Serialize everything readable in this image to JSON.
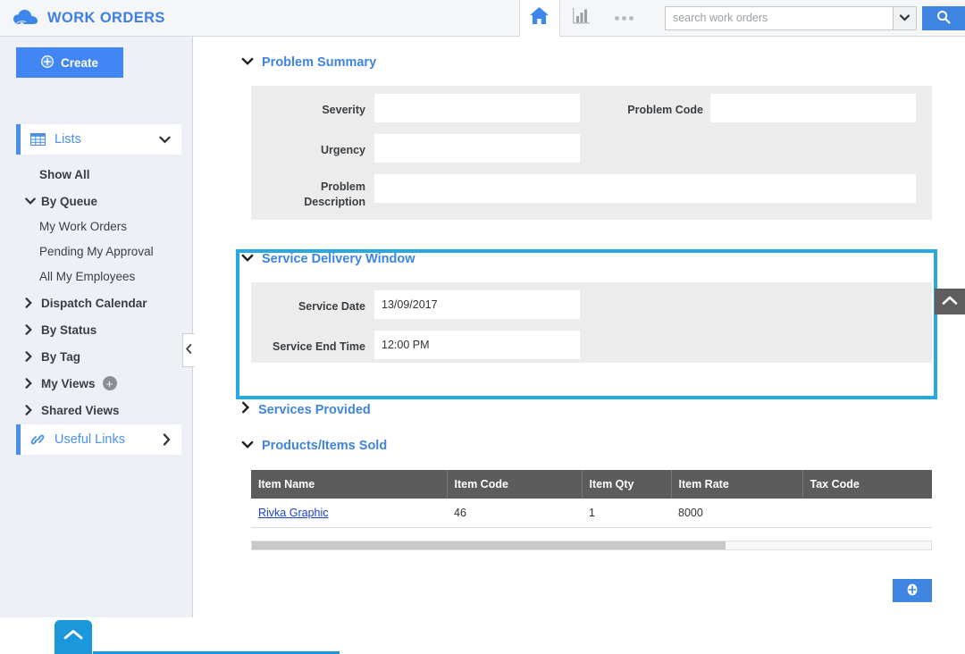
{
  "header": {
    "brand_title": "WORK ORDERS",
    "cloud_icon": "cloud-icon",
    "home_icon": "home-icon",
    "chart_icon": "bar-chart-icon",
    "more_icon": "ellipsis-icon",
    "search_placeholder": "search work orders",
    "search_value": "",
    "search_dropdown_icon": "chevron-down-icon",
    "search_button_icon": "search-icon",
    "accent_blue": "#3d85e0"
  },
  "sidebar": {
    "create_label": "Create",
    "create_icon": "plus-circle-icon",
    "lists": {
      "label": "Lists",
      "icon": "grid-icon",
      "chevron": "chevron-down-icon"
    },
    "useful_links": {
      "label": "Useful Links",
      "icon": "link-icon",
      "chevron": "chevron-right-icon"
    },
    "items": [
      {
        "label": "Show All",
        "type": "bold",
        "arrow": "none"
      },
      {
        "label": "By Queue",
        "type": "bold",
        "arrow": "chevron-down-icon"
      },
      {
        "label": "My Work Orders",
        "type": "child",
        "arrow": "none"
      },
      {
        "label": "Pending My Approval",
        "type": "child",
        "arrow": "none"
      },
      {
        "label": "All My Employees",
        "type": "child",
        "arrow": "none"
      },
      {
        "label": "Dispatch Calendar",
        "type": "bold",
        "arrow": "chevron-right-icon"
      },
      {
        "label": "By Status",
        "type": "bold",
        "arrow": "chevron-right-icon"
      },
      {
        "label": "By Tag",
        "type": "bold",
        "arrow": "chevron-right-icon"
      },
      {
        "label": "My Views",
        "type": "bold",
        "arrow": "chevron-right-icon",
        "badge": "+"
      },
      {
        "label": "Shared Views",
        "type": "bold",
        "arrow": "chevron-right-icon"
      }
    ],
    "collapse_icon": "chevron-left-icon",
    "scroll_top_icon": "chevron-up-icon",
    "accent_blue": "#4a90e8"
  },
  "main": {
    "sections": {
      "problem_summary": {
        "title": "Problem Summary",
        "chevron": "chevron-down-icon",
        "expanded": true,
        "fields": [
          {
            "label": "Severity",
            "value": ""
          },
          {
            "label": "Problem Code",
            "value": ""
          },
          {
            "label": "Urgency",
            "value": ""
          },
          {
            "label": "Problem Description",
            "value": ""
          }
        ]
      },
      "service_delivery_window": {
        "title": "Service Delivery Window",
        "chevron": "chevron-down-icon",
        "expanded": true,
        "highlighted": true,
        "highlight_color": "#27a9e3",
        "fields": [
          {
            "label": "Service Date",
            "value": "13/09/2017"
          },
          {
            "label": "Service End Time",
            "value": "12:00 PM"
          }
        ]
      },
      "services_provided": {
        "title": "Services Provided",
        "chevron": "chevron-right-icon",
        "expanded": false
      },
      "products_items_sold": {
        "title": "Products/Items Sold",
        "chevron": "chevron-down-icon",
        "expanded": true,
        "table": {
          "columns": [
            "Item Name",
            "Item Code",
            "Item Qty",
            "Item Rate",
            "Tax Code"
          ],
          "rows": [
            {
              "item_name": "Rivka Graphic",
              "item_code": "46",
              "item_qty": "1",
              "item_rate": "8000",
              "tax_code": ""
            }
          ]
        },
        "add_button_icon": "plus-circle-icon"
      }
    },
    "scroll_top_icon": "chevron-up-icon"
  }
}
